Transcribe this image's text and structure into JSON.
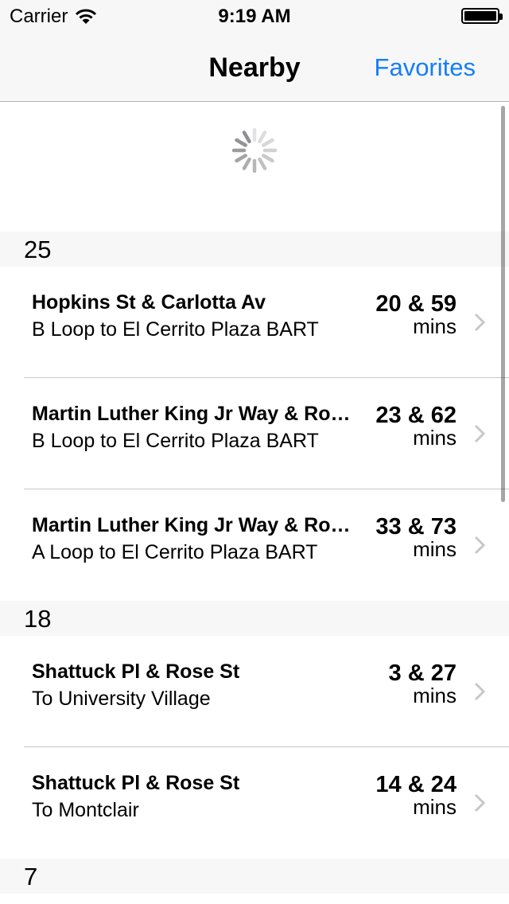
{
  "status_bar": {
    "carrier": "Carrier",
    "time": "9:19 AM"
  },
  "nav": {
    "title": "Nearby",
    "favorites_label": "Favorites"
  },
  "sections": [
    {
      "route": "25",
      "rows": [
        {
          "stop": "Hopkins St & Carlotta Av",
          "direction": "B Loop to El Cerrito Plaza BART",
          "times": "20 & 59",
          "unit": "mins"
        },
        {
          "stop": "Martin Luther King Jr Way & Ro…",
          "direction": "B Loop to El Cerrito Plaza BART",
          "times": "23 & 62",
          "unit": "mins"
        },
        {
          "stop": "Martin Luther King Jr Way & Ro…",
          "direction": "A Loop to El Cerrito Plaza BART",
          "times": "33 & 73",
          "unit": "mins"
        }
      ]
    },
    {
      "route": "18",
      "rows": [
        {
          "stop": "Shattuck Pl & Rose St",
          "direction": "To University Village",
          "times": "3 & 27",
          "unit": "mins"
        },
        {
          "stop": "Shattuck Pl & Rose St",
          "direction": "To Montclair",
          "times": "14 & 24",
          "unit": "mins"
        }
      ]
    },
    {
      "route": "7",
      "rows": []
    }
  ],
  "icons": {
    "wifi": "wifi-icon",
    "battery": "battery-icon",
    "spinner": "activity-spinner-icon",
    "chevron": "chevron-right-icon"
  },
  "colors": {
    "accent": "#147efb",
    "header_bg": "#f7f7f7",
    "separator": "#c8c7cc",
    "chevron": "#c7c7cc"
  }
}
